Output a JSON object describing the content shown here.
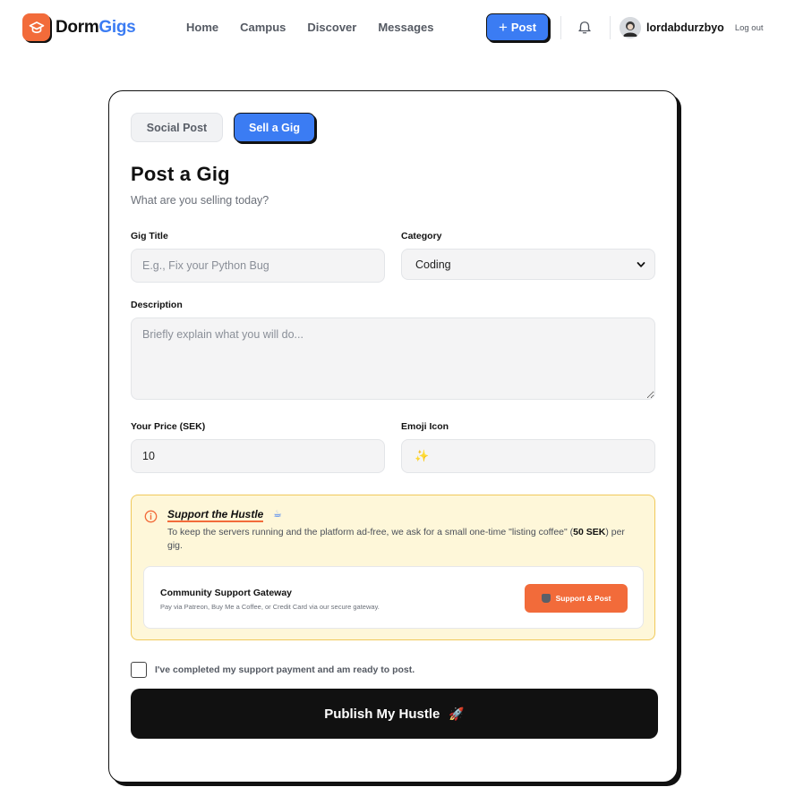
{
  "brand": {
    "name_part1": "Dorm",
    "name_part2": "Gigs",
    "accent": "#3b7cf3",
    "orange": "#f26b3a"
  },
  "nav": {
    "links": [
      "Home",
      "Campus",
      "Discover",
      "Messages"
    ],
    "post_plus": "+",
    "post_label": "Post",
    "username": "lordabdurzbyo",
    "logout": "Log out"
  },
  "tabs": {
    "social": "Social Post",
    "sell": "Sell a Gig",
    "active": "sell"
  },
  "form": {
    "title": "Post a Gig",
    "subtitle": "What are you selling today?",
    "gig_title_label": "Gig Title",
    "gig_title_placeholder": "E.g., Fix your Python Bug",
    "gig_title_value": "",
    "category_label": "Category",
    "category_value": "Coding",
    "description_label": "Description",
    "description_placeholder": "Briefly explain what you will do...",
    "price_label": "Your Price (SEK)",
    "price_value": "10",
    "emoji_label": "Emoji Icon",
    "emoji_value": "✨"
  },
  "support": {
    "title": "Support the Hustle",
    "title_emoji": "☕",
    "text_part1": "To keep the servers running and the platform ad-free, we ask for a small one-time \"listing coffee\" (",
    "text_bold": "50 SEK",
    "text_part2": ") per gig.",
    "gateway_title": "Community Support Gateway",
    "gateway_sub": "Pay via Patreon, Buy Me a Coffee, or Credit Card via our secure gateway.",
    "gateway_button": "Support & Post"
  },
  "confirm": {
    "label": "I've completed my support payment and am ready to post.",
    "checked": false
  },
  "publish": {
    "label": "Publish My Hustle",
    "emoji": "🚀"
  },
  "icons": [
    "graduation-cap-icon",
    "bell-icon",
    "chevron-down-icon",
    "info-icon",
    "coffee-icon",
    "rocket-icon"
  ]
}
